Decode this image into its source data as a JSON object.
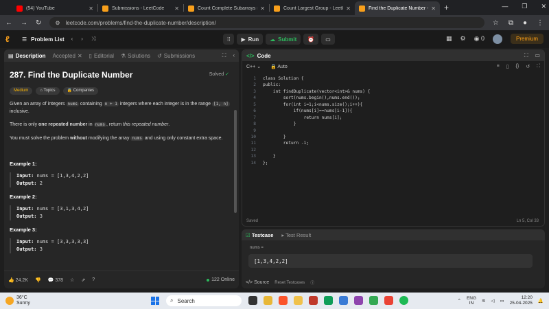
{
  "browser": {
    "tabs": [
      {
        "title": "(54) YouTube",
        "color": "#ff0000",
        "active": false
      },
      {
        "title": "Submissions - LeetCode",
        "color": "#f89f1b",
        "active": false
      },
      {
        "title": "Count Complete Subarrays in a",
        "color": "#f89f1b",
        "active": false
      },
      {
        "title": "Count Largest Group - LeetCod",
        "color": "#f89f1b",
        "active": false
      },
      {
        "title": "Find the Duplicate Number - Le",
        "color": "#f89f1b",
        "active": true
      }
    ],
    "url": "leetcode.com/problems/find-the-duplicate-number/description/"
  },
  "nav": {
    "problem_list": "Problem List",
    "run": "Run",
    "submit": "Submit",
    "streak": "0",
    "premium": "Premium"
  },
  "left": {
    "tabs": [
      "Description",
      "Accepted",
      "Editorial",
      "Solutions",
      "Submissions"
    ],
    "title": "287. Find the Duplicate Number",
    "solved": "Solved",
    "difficulty": "Medium",
    "topics": "Topics",
    "companies": "Companies",
    "p1_a": "Given an array of integers ",
    "p1_code1": "nums",
    "p1_b": " containing ",
    "p1_code2": "n + 1",
    "p1_c": " integers where each integer is in the range ",
    "p1_code3": "[1, n]",
    "p1_d": " inclusive.",
    "p2_a": "There is only ",
    "p2_bold": "one repeated number",
    "p2_b": " in ",
    "p2_code": "nums",
    "p2_c": ", return ",
    "p2_italic": "this repeated number",
    "p2_d": ".",
    "p3_a": "You must solve the problem ",
    "p3_bold": "without",
    "p3_b": " modifying the array ",
    "p3_code": "nums",
    "p3_c": " and using only constant extra space.",
    "examples": [
      {
        "heading": "Example 1:",
        "input": "nums = [1,3,4,2,2]",
        "output": "2"
      },
      {
        "heading": "Example 2:",
        "input": "nums = [3,1,3,4,2]",
        "output": "3"
      },
      {
        "heading": "Example 3:",
        "input": "nums = [3,3,3,3,3]",
        "output": "3"
      }
    ],
    "input_label": "Input:",
    "output_label": "Output:",
    "likes": "24.2K",
    "comments": "378",
    "online": "122 Online"
  },
  "code": {
    "title": "Code",
    "language": "C++",
    "auto": "Auto",
    "lines": [
      "class Solution {",
      "public:",
      "    int findDuplicate(vector<int>& nums) {",
      "        sort(nums.begin(),nums.end());",
      "        for(int i=1;i<nums.size();i++){",
      "            if(nums[i]==nums[i-1]){",
      "                return nums[i];",
      "            }",
      "",
      "        }",
      "        return -1;",
      "",
      "    }",
      "};"
    ],
    "saved": "Saved",
    "cursor": "Ln 5, Col 33"
  },
  "testcase": {
    "tab_testcase": "Testcase",
    "tab_result": "Test Result",
    "label": "nums =",
    "value": "[1,3,4,2,2]",
    "source": "Source",
    "reset": "Reset Testcases"
  },
  "taskbar": {
    "temp": "36°C",
    "weather": "Sunny",
    "search": "Search",
    "lang1": "ENG",
    "lang2": "IN",
    "time": "12:20",
    "date": "25-04-2025"
  }
}
